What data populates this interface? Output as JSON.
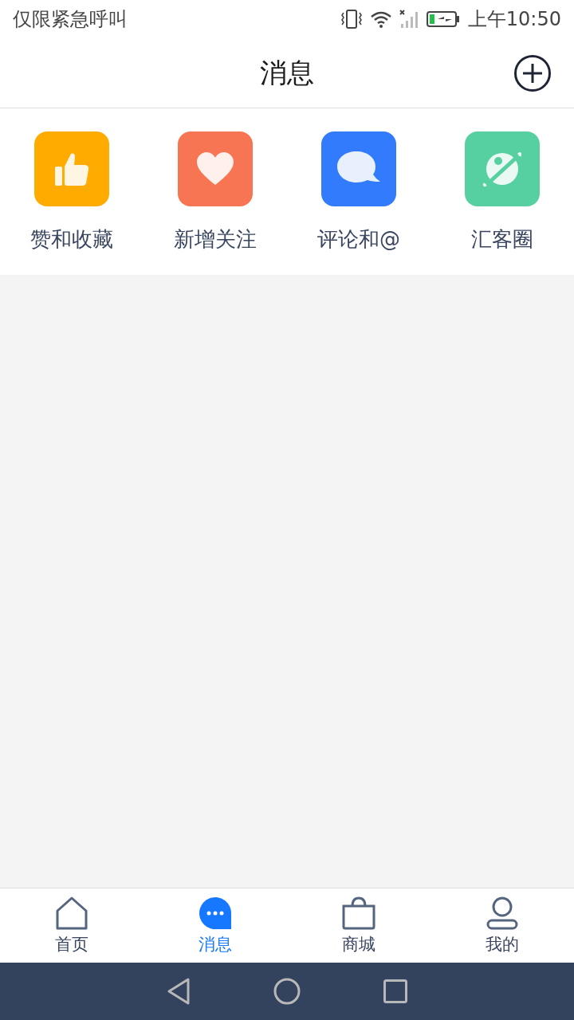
{
  "status_bar": {
    "carrier": "仅限紧急呼叫",
    "time": "上午10:50"
  },
  "header": {
    "title": "消息"
  },
  "shortcuts": [
    {
      "label": "赞和收藏",
      "kind": "like",
      "color": "#ffab00"
    },
    {
      "label": "新增关注",
      "kind": "follow",
      "color": "#f87553"
    },
    {
      "label": "评论和@",
      "kind": "comment",
      "color": "#317bfc"
    },
    {
      "label": "汇客圈",
      "kind": "circle",
      "color": "#56d0a0"
    }
  ],
  "tab_bar": [
    {
      "label": "首页",
      "kind": "home",
      "selected": false
    },
    {
      "label": "消息",
      "kind": "message",
      "selected": true
    },
    {
      "label": "商城",
      "kind": "shop",
      "selected": false
    },
    {
      "label": "我的",
      "kind": "me",
      "selected": false
    }
  ]
}
